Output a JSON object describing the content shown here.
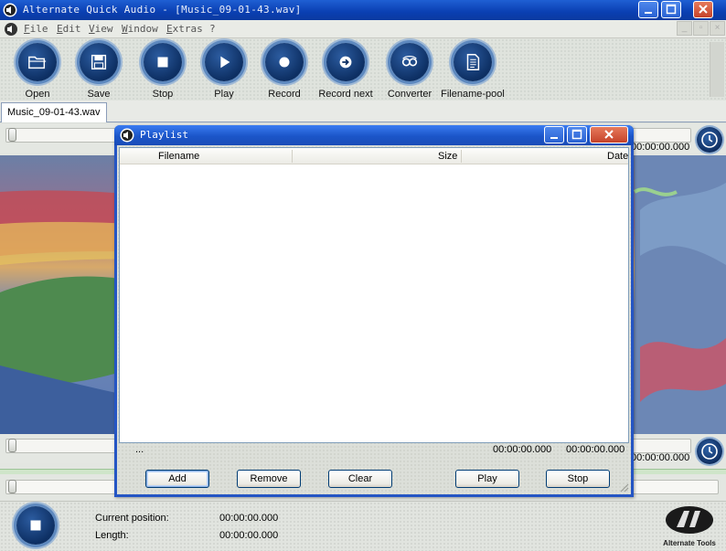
{
  "window": {
    "title": "Alternate Quick Audio - [Music_09-01-43.wav]",
    "buttons": {
      "minimize": "_",
      "maximize": "□",
      "close": "×"
    }
  },
  "menu": {
    "items": [
      "File",
      "Edit",
      "View",
      "Window",
      "Extras",
      "?"
    ]
  },
  "toolbar": {
    "buttons": [
      {
        "label": "Open",
        "icon": "folder-icon"
      },
      {
        "label": "Save",
        "icon": "floppy-icon"
      },
      {
        "label": "Stop",
        "icon": "stop-icon"
      },
      {
        "label": "Play",
        "icon": "play-icon"
      },
      {
        "label": "Record",
        "icon": "record-icon"
      },
      {
        "label": "Record next",
        "icon": "record-next-icon"
      },
      {
        "label": "Converter",
        "icon": "converter-icon"
      },
      {
        "label": "Filename-pool",
        "icon": "document-icon"
      }
    ]
  },
  "tabs": [
    {
      "label": "Music_09-01-43.wav"
    }
  ],
  "document": {
    "top_time": "00:00:00.000",
    "bottom_time": "00:00:00.000"
  },
  "playlist": {
    "title": "Playlist",
    "columns": [
      "Filename",
      "Size",
      "Date"
    ],
    "rows": [],
    "status_left": "...",
    "time_1": "00:00:00.000",
    "time_2": "00:00:00.000",
    "buttons": {
      "add": "Add",
      "remove": "Remove",
      "clear": "Clear",
      "play": "Play",
      "stop": "Stop"
    }
  },
  "status": {
    "current_position_label": "Current position:",
    "current_position_value": "00:00:00.000",
    "length_label": "Length:",
    "length_value": "00:00:00.000",
    "brand": "Alternate Tools"
  },
  "colors": {
    "titlebar": "#0a3fb2",
    "accent_blue": "#1b55c9",
    "icon_ring": "#0d2f63"
  }
}
